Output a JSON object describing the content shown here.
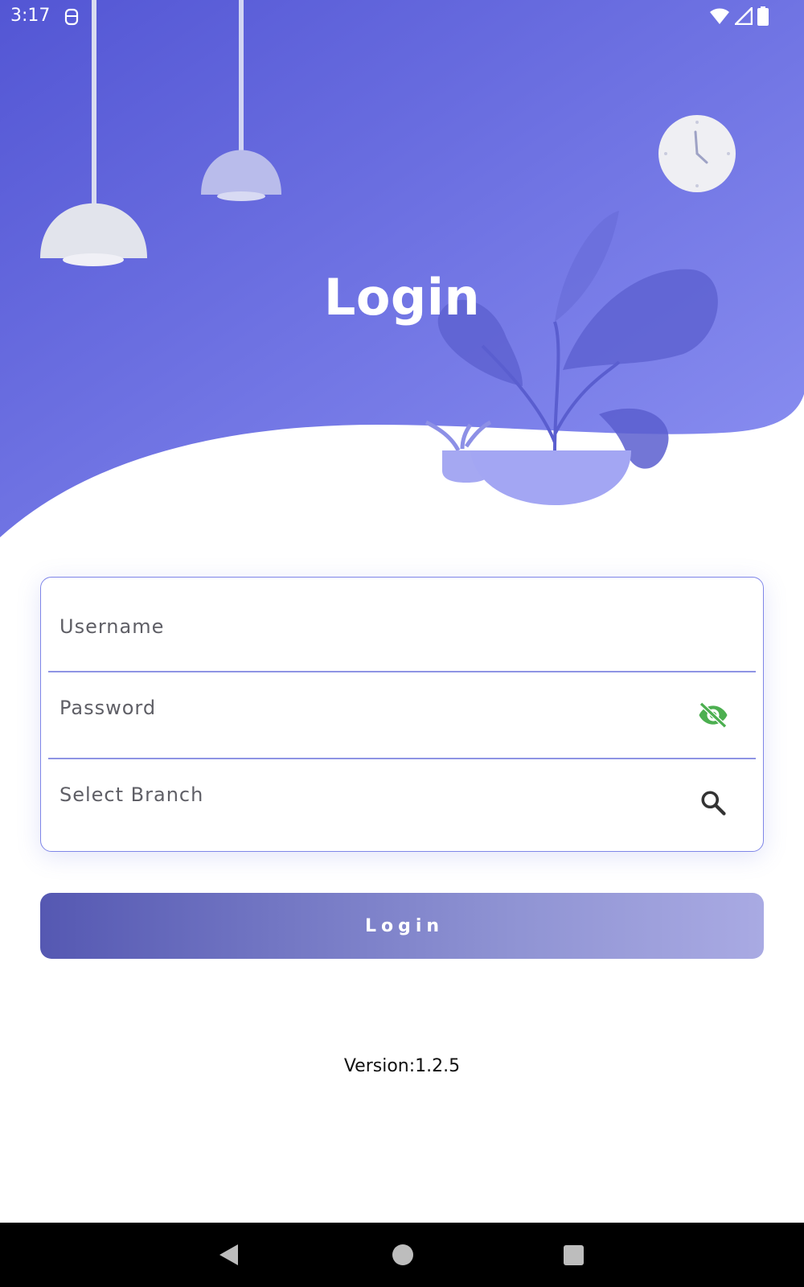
{
  "status_bar": {
    "time": "3:17"
  },
  "header": {
    "title": "Login"
  },
  "form": {
    "username": {
      "placeholder": "Username",
      "value": ""
    },
    "password": {
      "placeholder": "Password",
      "value": "",
      "toggle_icon": "visibility-off-icon"
    },
    "branch": {
      "placeholder": "Select Branch",
      "value": "",
      "icon": "search-icon"
    }
  },
  "login_button": {
    "label": "Login"
  },
  "footer": {
    "version": "Version:1.2.5"
  },
  "colors": {
    "header_gradient_start": "#5356d4",
    "header_gradient_end": "#8a8ff0",
    "accent": "#7f86e8",
    "visibility_icon": "#4caf50"
  }
}
